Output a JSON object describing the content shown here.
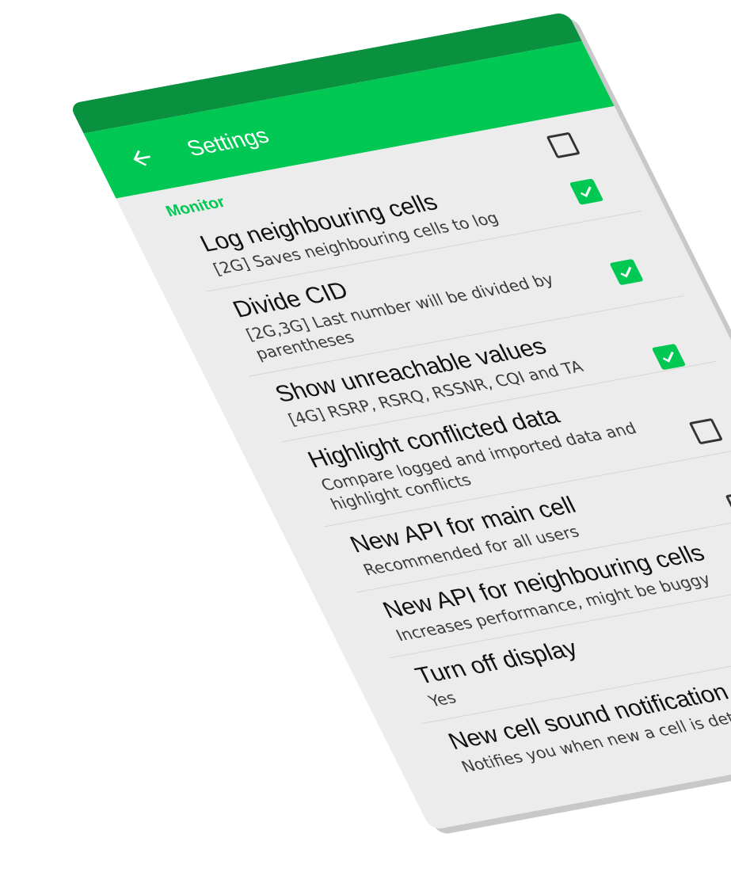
{
  "colors": {
    "status_bar": "#099140",
    "toolbar": "#00c853",
    "accent": "#00c853",
    "background": "#ececec"
  },
  "toolbar": {
    "back_icon": "arrow-back-icon",
    "title": "Settings"
  },
  "section": {
    "header": "Monitor"
  },
  "items": [
    {
      "title": "Log neighbouring cells",
      "summary": "[2G] Saves neighbouring cells to log",
      "checked": false,
      "has_checkbox": true
    },
    {
      "title": "Divide CID",
      "summary": "[2G,3G] Last number will be divided by parentheses",
      "checked": true,
      "has_checkbox": true
    },
    {
      "title": "Show unreachable values",
      "summary": "[4G] RSRP, RSRQ, RSSNR, CQI and TA",
      "checked": true,
      "has_checkbox": true
    },
    {
      "title": "Highlight conflicted data",
      "summary": "Compare logged and imported data and highlight conflicts",
      "checked": true,
      "has_checkbox": true
    },
    {
      "title": "New API for main cell",
      "summary": "Recommended for all users",
      "checked": false,
      "has_checkbox": true
    },
    {
      "title": "New API for neighbouring cells",
      "summary": "Increases performance, might be buggy",
      "checked": false,
      "has_checkbox": true
    },
    {
      "title": "Turn off display",
      "summary": "Yes",
      "checked": false,
      "has_checkbox": false
    },
    {
      "title": "New cell sound notification",
      "summary": "Notifies you when new a cell is detected",
      "checked": false,
      "has_checkbox": true
    }
  ]
}
